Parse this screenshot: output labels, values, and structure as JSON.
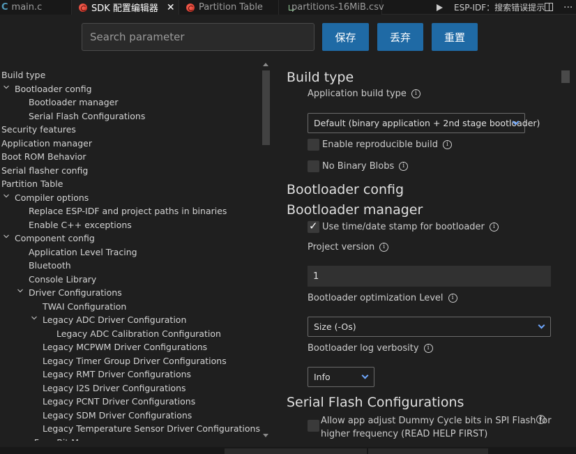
{
  "tabs": {
    "c_mark": "C",
    "main_c": "main.c",
    "sdk": "SDK 配置编辑器",
    "close": "✕",
    "partition": "Partition Table",
    "csv": "partitions-16MiB.csv",
    "esp_hint": "ESP-IDF：搜索错误提示",
    "more": "···"
  },
  "search": {
    "placeholder": "Search parameter"
  },
  "buttons": {
    "save": "保存",
    "discard": "丢弃",
    "reset": "重置"
  },
  "tree": [
    {
      "label": "Build type",
      "chevron": ""
    },
    {
      "label": "Bootloader config",
      "chevron": "open"
    },
    {
      "label": "Bootloader manager",
      "chevron": ""
    },
    {
      "label": "Serial Flash Configurations",
      "chevron": ""
    },
    {
      "label": "Security features",
      "chevron": ""
    },
    {
      "label": "Application manager",
      "chevron": ""
    },
    {
      "label": "Boot ROM Behavior",
      "chevron": ""
    },
    {
      "label": "Serial flasher config",
      "chevron": ""
    },
    {
      "label": "Partition Table",
      "chevron": ""
    },
    {
      "label": "Compiler options",
      "chevron": "open"
    },
    {
      "label": "Replace ESP-IDF and project paths in binaries",
      "chevron": ""
    },
    {
      "label": "Enable C++ exceptions",
      "chevron": ""
    },
    {
      "label": "Component config",
      "chevron": "open"
    },
    {
      "label": "Application Level Tracing",
      "chevron": ""
    },
    {
      "label": "Bluetooth",
      "chevron": ""
    },
    {
      "label": "Console Library",
      "chevron": ""
    },
    {
      "label": "Driver Configurations",
      "chevron": "open"
    },
    {
      "label": "TWAI Configuration",
      "chevron": ""
    },
    {
      "label": "Legacy ADC Driver Configuration",
      "chevron": "open"
    },
    {
      "label": "Legacy ADC Calibration Configuration",
      "chevron": ""
    },
    {
      "label": "Legacy MCPWM Driver Configurations",
      "chevron": ""
    },
    {
      "label": "Legacy Timer Group Driver Configurations",
      "chevron": ""
    },
    {
      "label": "Legacy RMT Driver Configurations",
      "chevron": ""
    },
    {
      "label": "Legacy I2S Driver Configurations",
      "chevron": ""
    },
    {
      "label": "Legacy PCNT Driver Configurations",
      "chevron": ""
    },
    {
      "label": "Legacy SDM Driver Configurations",
      "chevron": ""
    },
    {
      "label": "Legacy Temperature Sensor Driver Configurations",
      "chevron": ""
    },
    {
      "label": "eFuse Bit Manager",
      "chevron": ""
    }
  ],
  "panel": {
    "build_type_title": "Build type",
    "app_build_type_label": "Application build type",
    "app_build_type_value": "Default (binary application + 2nd stage bootloader)",
    "reproducible_label": "Enable reproducible build",
    "reproducible_checked": false,
    "no_blobs_label": "No Binary Blobs",
    "no_blobs_checked": false,
    "bootloader_config_title": "Bootloader config",
    "bootloader_manager_title": "Bootloader manager",
    "timestamp_label": "Use time/date stamp for bootloader",
    "timestamp_checked": true,
    "project_version_label": "Project version",
    "project_version_value": "1",
    "opt_level_label": "Bootloader optimization Level",
    "opt_level_value": "Size (-Os)",
    "log_verbosity_label": "Bootloader log verbosity",
    "log_verbosity_value": "Info",
    "serial_flash_title": "Serial Flash Configurations",
    "dummy_cycle_label_1": "Allow app adjust Dummy Cycle bits in SPI Flash for",
    "dummy_cycle_label_2": "higher frequency (READ HELP FIRST)",
    "dummy_cycle_checked": false,
    "info_glyph": "i"
  }
}
